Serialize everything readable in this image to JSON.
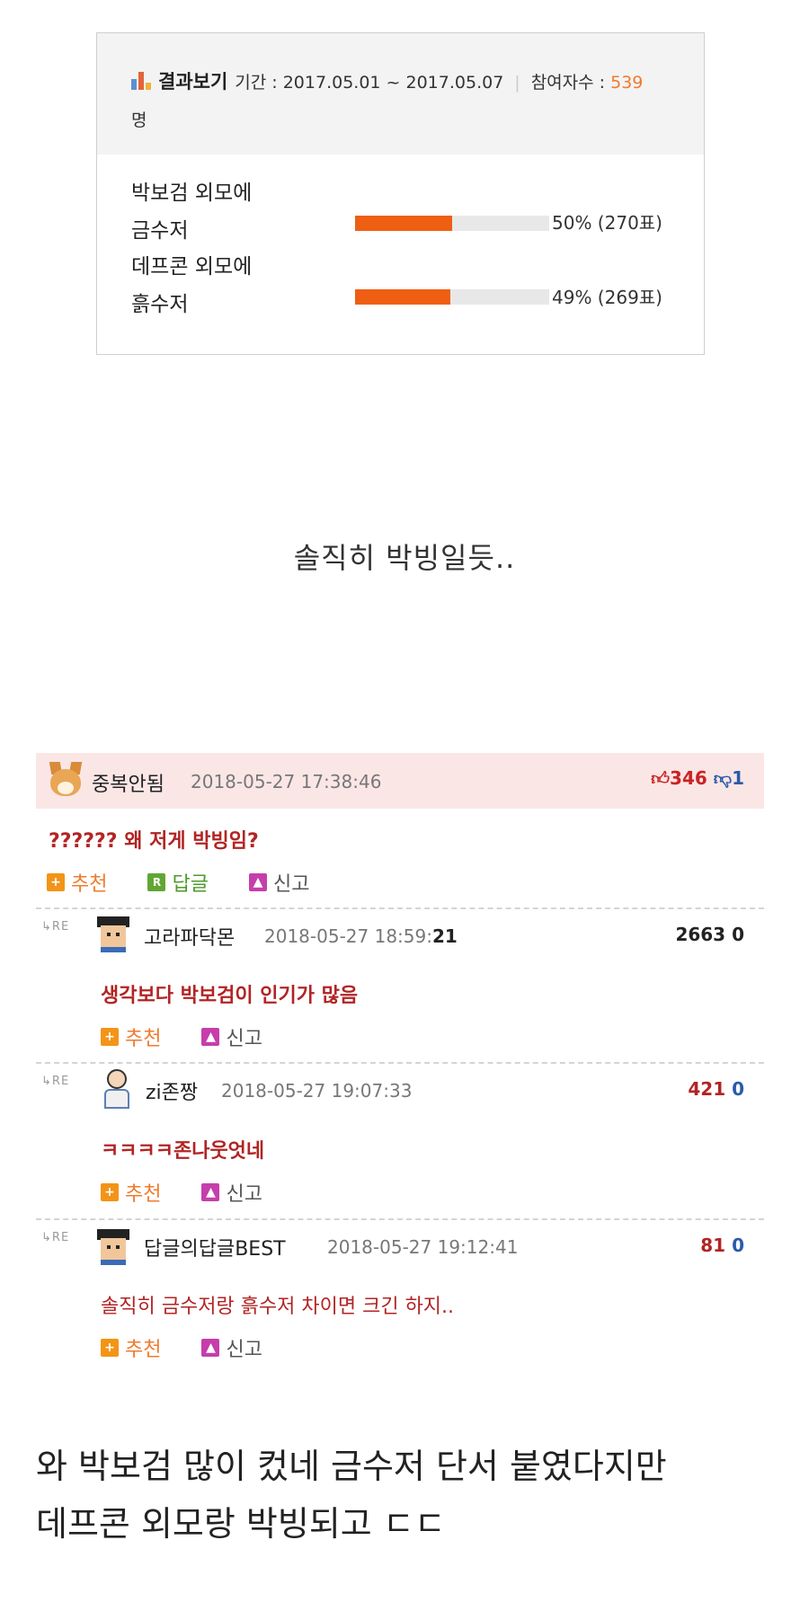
{
  "poll": {
    "title": "결과보기",
    "period_label": "기간 : 2017.05.01 ~ 2017.05.07",
    "participants_label": "참여자수 : ",
    "participants_count": "539",
    "participants_unit": "명",
    "options": [
      {
        "label_line1": "박보검 외모에",
        "label_line2": "금수저",
        "percent": 50,
        "result": "50% (270표)"
      },
      {
        "label_line1": "데프콘 외모에",
        "label_line2": "흙수저",
        "percent": 49,
        "result": "49% (269표)"
      }
    ]
  },
  "caption1": "솔직히 박빙일듯..",
  "comments": {
    "top": {
      "nick": "중복안됨",
      "date": "2018-05-27 17:38:46",
      "up": "346",
      "down": "1",
      "text": "?????? 왜 저게 박빙임?",
      "actions": {
        "recommend": "추천",
        "reply": "답글",
        "report": "신고"
      }
    },
    "replies": [
      {
        "re": "RE",
        "nick": "고라파닥몬",
        "date": "2018-05-27 18:59:",
        "date_bold": "21",
        "up": "2663",
        "down": "0",
        "text": "생각보다 박보검이 인기가 많음",
        "recommend": "추천",
        "report": "신고"
      },
      {
        "re": "RE",
        "nick": "zi존짱",
        "date": "2018-05-27 19:07:33",
        "up": "421",
        "down": "0",
        "text": "ㅋㅋㅋㅋ존나웃엇네",
        "recommend": "추천",
        "report": "신고"
      },
      {
        "re": "RE",
        "nick": "답글의답글BEST",
        "date": "2018-05-27 19:12:41",
        "up": "81",
        "down": "0",
        "text": "솔직히 금수저랑 흙수저 차이면 크긴 하지..",
        "recommend": "추천",
        "report": "신고"
      }
    ]
  },
  "caption2": {
    "line1": "와 박보검 많이 컸네 금수저 단서 붙였다지만",
    "line2": "데프콘 외모랑 박빙되고 ㄷㄷ"
  }
}
